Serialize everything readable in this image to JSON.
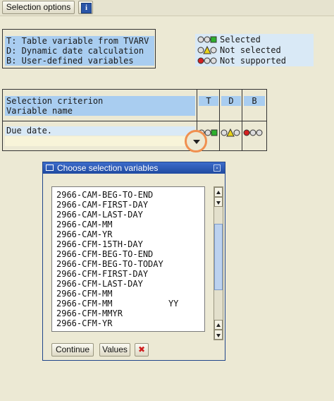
{
  "toolbar": {
    "selection_options_label": "Selection options",
    "info_icon_glyph": "i"
  },
  "legend": {
    "lines": [
      "T: Table variable from TVARV",
      "D: Dynamic date calculation",
      "B: User-defined variables"
    ]
  },
  "status": [
    {
      "label": "Selected",
      "icon": "green-status-icon"
    },
    {
      "label": "Not selected",
      "icon": "yellow-status-icon"
    },
    {
      "label": "Not supported",
      "icon": "red-status-icon"
    }
  ],
  "grid": {
    "header_criterion": "Selection criterion",
    "header_variable": "Variable name",
    "col_t": "T",
    "col_d": "D",
    "col_b": "B",
    "row_label": "Due date."
  },
  "popup": {
    "title": "Choose selection variables",
    "items": [
      "2966-CAM-BEG-TO-END",
      "2966-CAM-FIRST-DAY",
      "2966-CAM-LAST-DAY",
      "2966-CAM-MM",
      "2966-CAM-YR",
      "2966-CFM-15TH-DAY",
      "2966-CFM-BEG-TO-END",
      "2966-CFM-BEG-TO-TODAY",
      "2966-CFM-FIRST-DAY",
      "2966-CFM-LAST-DAY",
      "2966-CFM-MM",
      "2966-CFM-MM           YY",
      "2966-CFM-MMYR",
      "2966-CFM-YR"
    ],
    "continue_label": "Continue",
    "values_label": "Values",
    "cancel_glyph": "✖"
  },
  "colors": {
    "background": "#ece9d4",
    "highlight": "#a9cdf0",
    "title_bar": "#1f4aa0",
    "callout": "#f09050",
    "status_green": "#2db02d",
    "status_yellow": "#e8d21a",
    "status_red": "#d42020"
  }
}
